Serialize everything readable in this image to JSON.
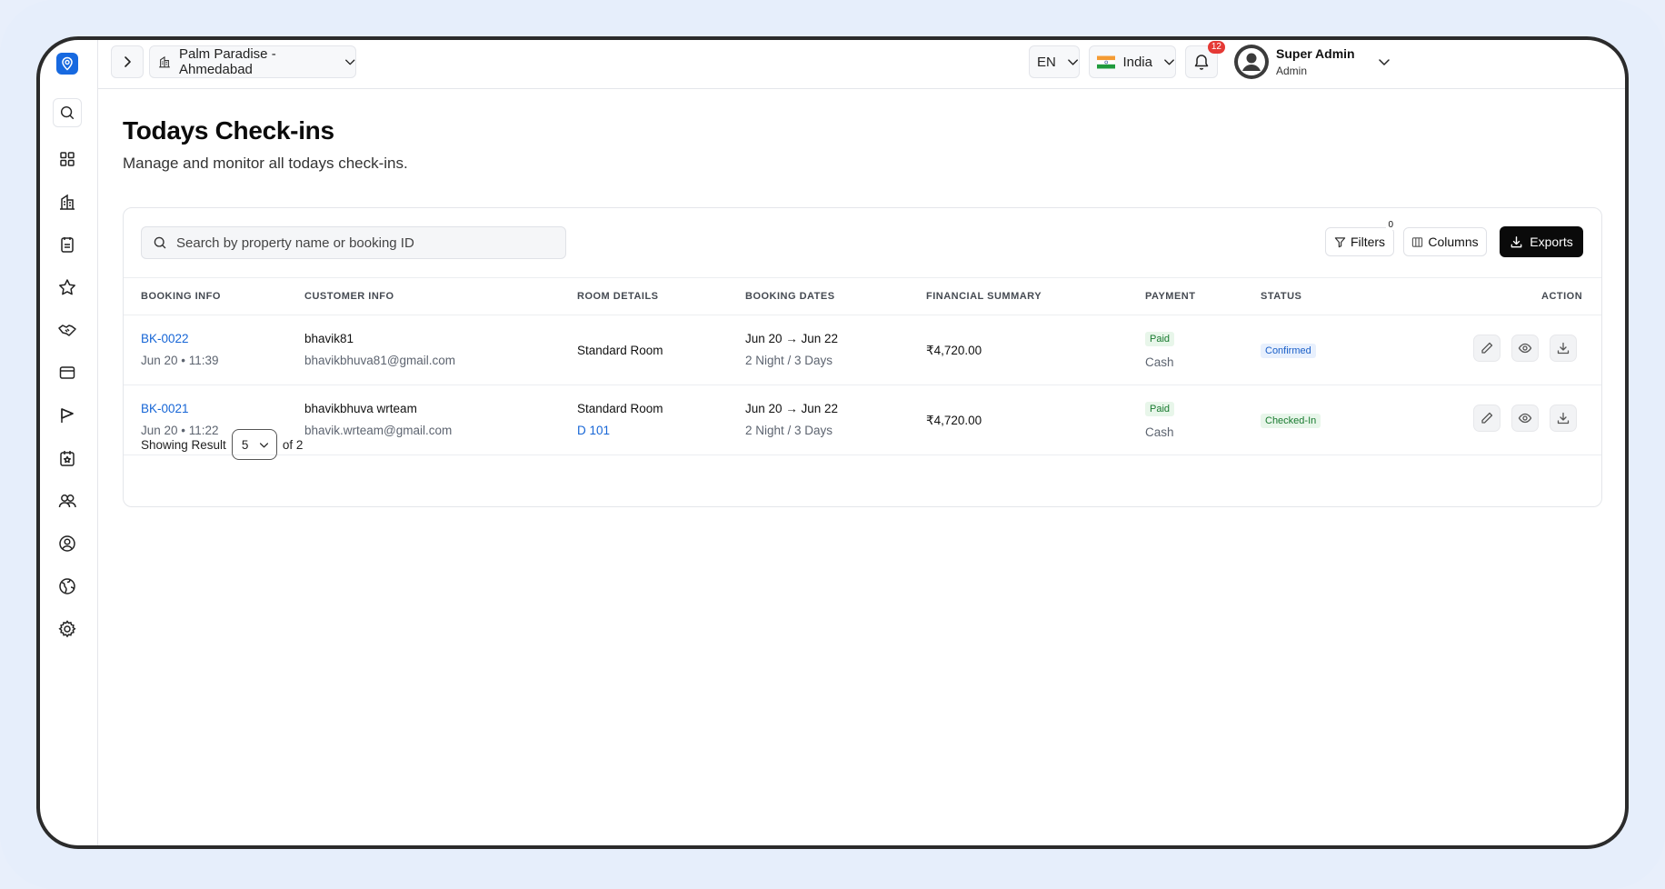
{
  "header": {
    "property_name": "Palm Paradise - Ahmedabad",
    "language": "EN",
    "country": "India",
    "notification_count": "12",
    "user_name": "Super Admin",
    "user_role": "Admin"
  },
  "page": {
    "title": "Todays Check-ins",
    "subtitle": "Manage and monitor all todays check-ins."
  },
  "toolbar": {
    "search_placeholder": "Search by property name or booking ID",
    "filters_label": "Filters",
    "filters_count": "0",
    "columns_label": "Columns",
    "exports_label": "Exports"
  },
  "table": {
    "headers": [
      "BOOKING INFO",
      "CUSTOMER INFO",
      "ROOM DETAILS",
      "BOOKING DATES",
      "FINANCIAL SUMMARY",
      "PAYMENT",
      "STATUS",
      "ACTION"
    ],
    "rows": [
      {
        "booking_id": "BK-0022",
        "booking_time": "Jun 20 • 11:39",
        "customer_name": "bhavik81",
        "customer_email": "bhavikbhuva81@gmail.com",
        "room_type": "Standard Room",
        "room_number": "",
        "dates": "Jun 20 → Jun 22",
        "duration": "2 Night / 3 Days",
        "amount": "₹4,720.00",
        "payment_status": "Paid",
        "payment_method": "Cash",
        "status": "Confirmed"
      },
      {
        "booking_id": "BK-0021",
        "booking_time": "Jun 20 • 11:22",
        "customer_name": "bhavikbhuva wrteam",
        "customer_email": "bhavik.wrteam@gmail.com",
        "room_type": "Standard Room",
        "room_number": "D 101",
        "dates": "Jun 20 → Jun 22",
        "duration": "2 Night / 3 Days",
        "amount": "₹4,720.00",
        "payment_status": "Paid",
        "payment_method": "Cash",
        "status": "Checked-In"
      }
    ]
  },
  "pagination": {
    "prefix": "Showing Result",
    "page_size": "5",
    "suffix": "of 2"
  },
  "colors": {
    "accent": "#1769e0",
    "link": "#1766d6",
    "success": "#187a2f",
    "badge_red": "#e53935"
  }
}
